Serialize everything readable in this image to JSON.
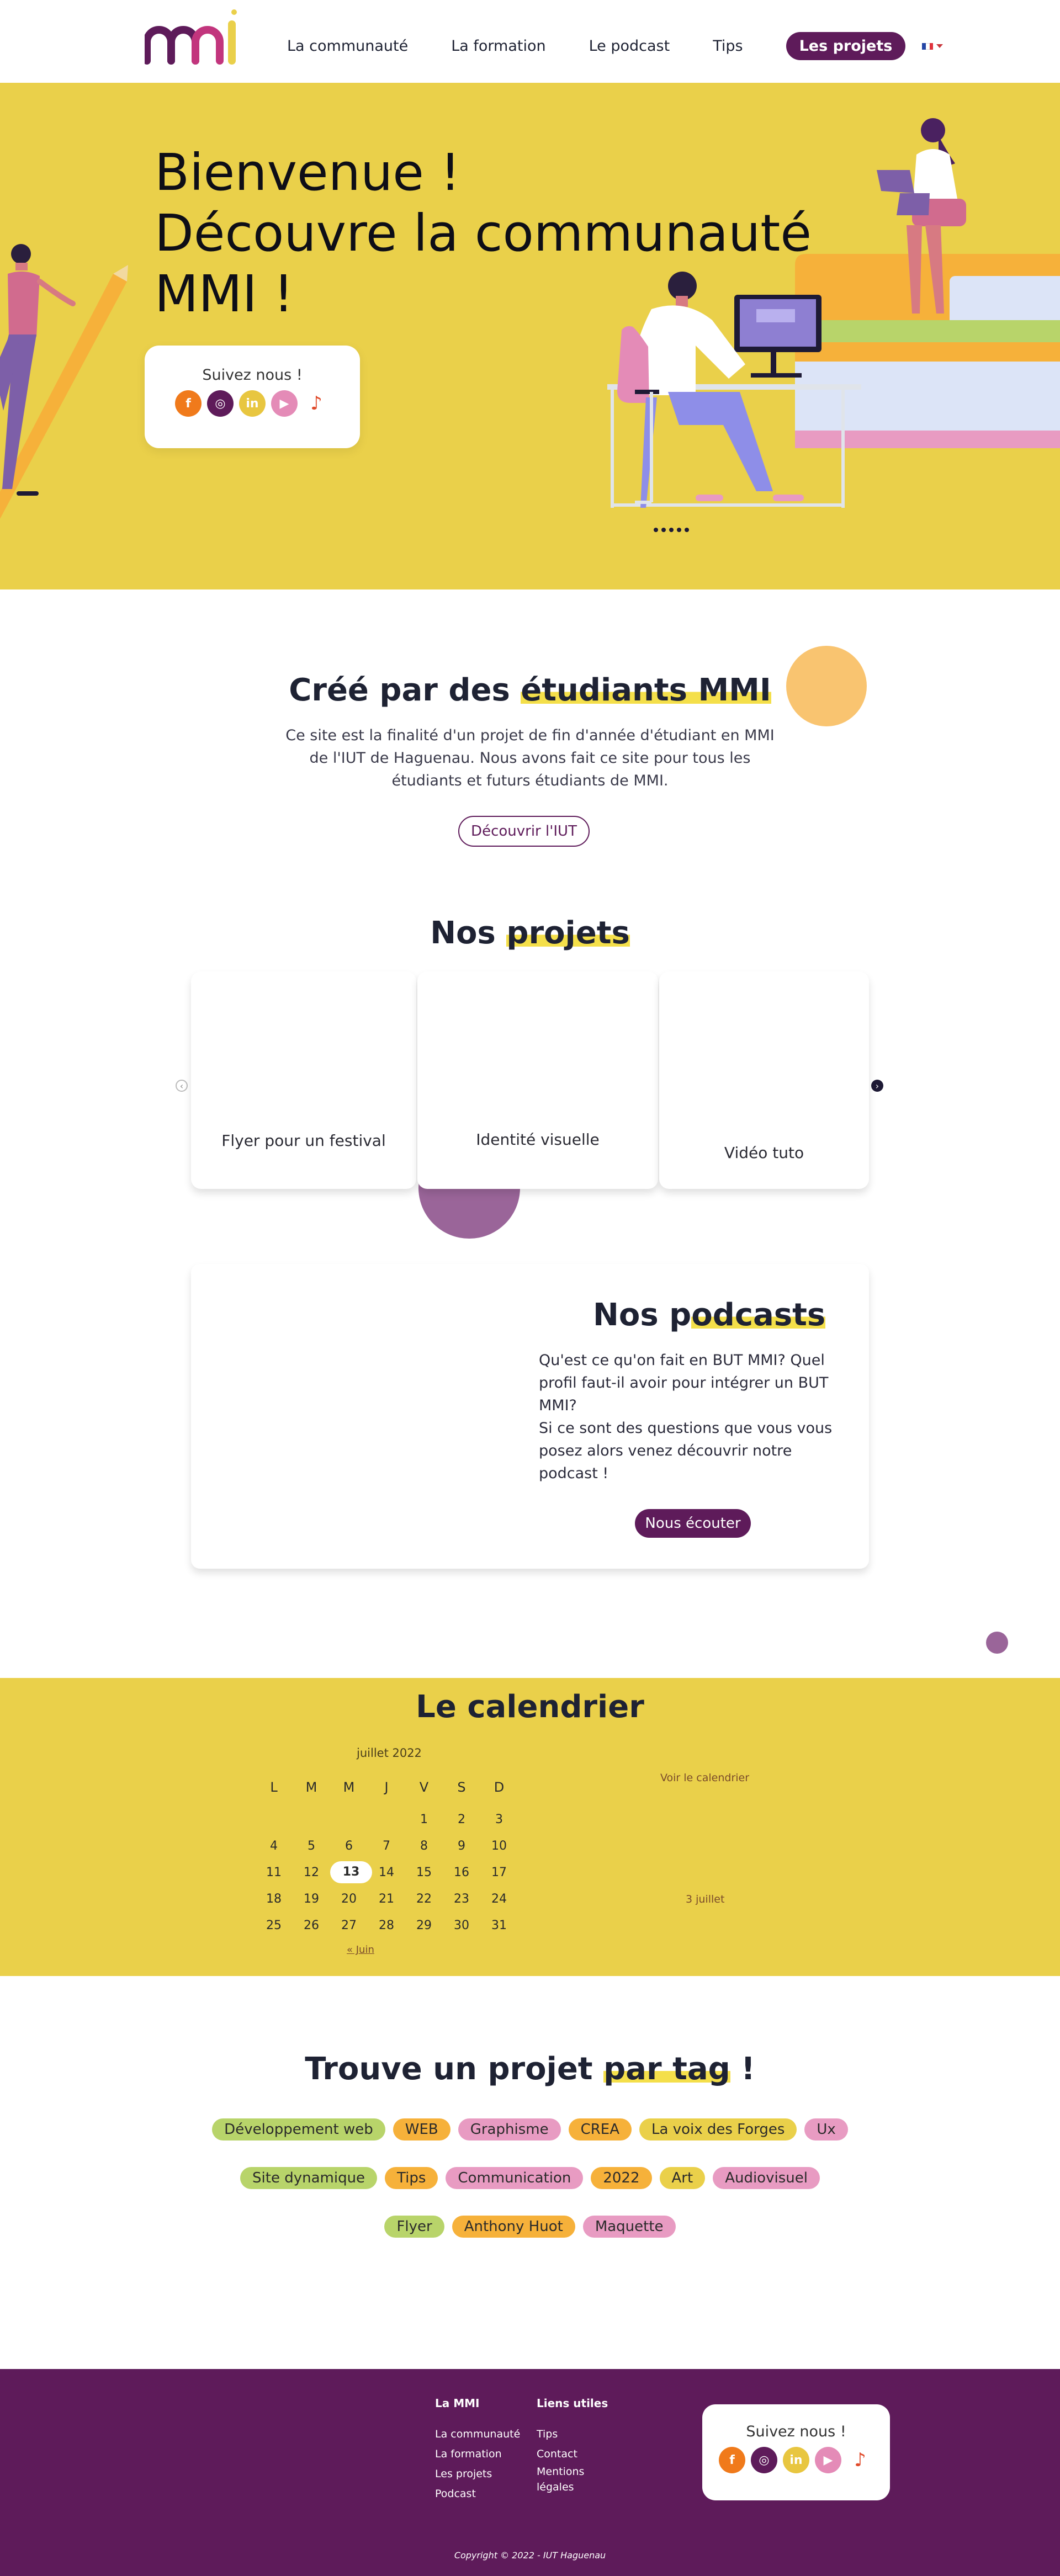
{
  "header": {
    "logo_text": "mmi",
    "nav": [
      "La communauté",
      "La formation",
      "Le podcast",
      "Tips"
    ],
    "nav_active": "Les projets",
    "colors": {
      "brand": "#5e1b5a",
      "yellow": "#ead04a"
    }
  },
  "hero": {
    "title_lines": [
      "Bienvenue !",
      "Découvre la communauté",
      "MMI !"
    ],
    "follow_label": "Suivez nous !",
    "socials": [
      {
        "name": "facebook-icon",
        "glyph": "f",
        "color": "#f07a1b"
      },
      {
        "name": "instagram-icon",
        "glyph": "◎",
        "color": "#5e1b5a"
      },
      {
        "name": "linkedin-icon",
        "glyph": "in",
        "color": "#e8c640"
      },
      {
        "name": "youtube-icon",
        "glyph": "▶",
        "color": "#e48bb7"
      },
      {
        "name": "tiktok-icon",
        "glyph": "♪",
        "color": "#ffffff"
      }
    ]
  },
  "intro": {
    "title_prefix": "Créé par des ",
    "title_highlight": "étudiants MMI",
    "text": "Ce site est la finalité d'un projet de fin d'année d'étudiant en MMI de l'IUT de Haguenau. Nous avons fait ce site pour tous les étudiants et futurs étudiants de MMI.",
    "button": "Découvrir l'IUT"
  },
  "projects": {
    "title_prefix": "Nos ",
    "title_highlight": "projets",
    "cards": [
      "Flyer pour un festival",
      "Identité visuelle",
      "Vidéo tuto"
    ]
  },
  "podcasts": {
    "title_prefix": "Nos p",
    "title_highlight": "odcasts",
    "lines": [
      "Qu'est ce qu'on fait en BUT MMI? Quel profil faut-il avoir pour intégrer un BUT MMI?",
      "Si ce sont des questions que vous vous posez alors venez découvrir notre podcast !"
    ],
    "button": "Nous écouter"
  },
  "calendar": {
    "title": "Le calendrier",
    "month": "juillet 2022",
    "weekdays": [
      "L",
      "M",
      "M",
      "J",
      "V",
      "S",
      "D"
    ],
    "weeks": [
      [
        "",
        "",
        "",
        "",
        "1",
        "2",
        "3"
      ],
      [
        "4",
        "5",
        "6",
        "7",
        "8",
        "9",
        "10"
      ],
      [
        "11",
        "12",
        "13",
        "14",
        "15",
        "16",
        "17"
      ],
      [
        "18",
        "19",
        "20",
        "21",
        "22",
        "23",
        "24"
      ],
      [
        "25",
        "26",
        "27",
        "28",
        "29",
        "30",
        "31"
      ]
    ],
    "today": "13",
    "prev_link": "« Juin",
    "view_link": "Voir le calendrier",
    "event": "3 juillet"
  },
  "tags": {
    "title_prefix": "Trouve un projet ",
    "title_highlight": "par tag",
    "title_suffix": " !",
    "rows": [
      [
        {
          "label": "Développement web",
          "color": "#b8d46a"
        },
        {
          "label": "WEB",
          "color": "#f6b13a"
        },
        {
          "label": "Graphisme",
          "color": "#e89bc2"
        },
        {
          "label": "CREA",
          "color": "#f6b13a"
        },
        {
          "label": "La voix des Forges",
          "color": "#ead04a"
        },
        {
          "label": "Ux",
          "color": "#e89bc2"
        }
      ],
      [
        {
          "label": "Site dynamique",
          "color": "#b8d46a"
        },
        {
          "label": "Tips",
          "color": "#f6b13a"
        },
        {
          "label": "Communication",
          "color": "#e89bc2"
        },
        {
          "label": "2022",
          "color": "#f6b13a"
        },
        {
          "label": "Art",
          "color": "#ead04a"
        },
        {
          "label": "Audiovisuel",
          "color": "#e89bc2"
        }
      ],
      [
        {
          "label": "Flyer",
          "color": "#b8d46a"
        },
        {
          "label": "Anthony Huot",
          "color": "#f6b13a"
        },
        {
          "label": "Maquette",
          "color": "#e89bc2"
        }
      ]
    ]
  },
  "footer": {
    "col1_title": "La MMI",
    "col1_links": [
      "La communauté",
      "La formation",
      "Les projets",
      "Podcast"
    ],
    "col2_title": "Liens utiles",
    "col2_links": [
      "Tips",
      "Contact",
      "Mentions",
      "légales"
    ],
    "follow_label": "Suivez nous !",
    "copyright": "Copyright © 2022 - IUT Haguenau"
  }
}
